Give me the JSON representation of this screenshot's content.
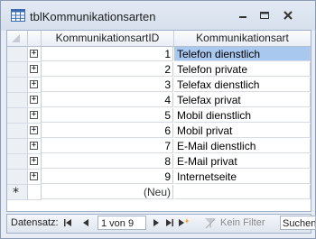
{
  "window": {
    "title": "tblKommunikationsarten",
    "table_icon": "table-icon",
    "buttons": [
      "minimize-icon",
      "restore-icon",
      "close-icon"
    ]
  },
  "grid": {
    "columns": [
      "KommunikationsartID",
      "Kommunikationsart"
    ],
    "rows": [
      {
        "id": "1",
        "art": "Telefon dienstlich"
      },
      {
        "id": "2",
        "art": "Telefon private"
      },
      {
        "id": "3",
        "art": "Telefax dienstlich"
      },
      {
        "id": "4",
        "art": "Telefax privat"
      },
      {
        "id": "5",
        "art": "Mobil dienstlich"
      },
      {
        "id": "6",
        "art": "Mobil privat"
      },
      {
        "id": "7",
        "art": "E-Mail dienstlich"
      },
      {
        "id": "8",
        "art": "E-Mail privat"
      },
      {
        "id": "9",
        "art": "Internetseite"
      }
    ],
    "new_row": {
      "id": "(Neu)",
      "art": ""
    },
    "selected_row": 0,
    "selection_color": "#a9c8ef"
  },
  "statusbar": {
    "label": "Datensatz:",
    "record_value": "1 von 9",
    "filter_label": "Kein Filter",
    "search_label": "Suchen"
  }
}
